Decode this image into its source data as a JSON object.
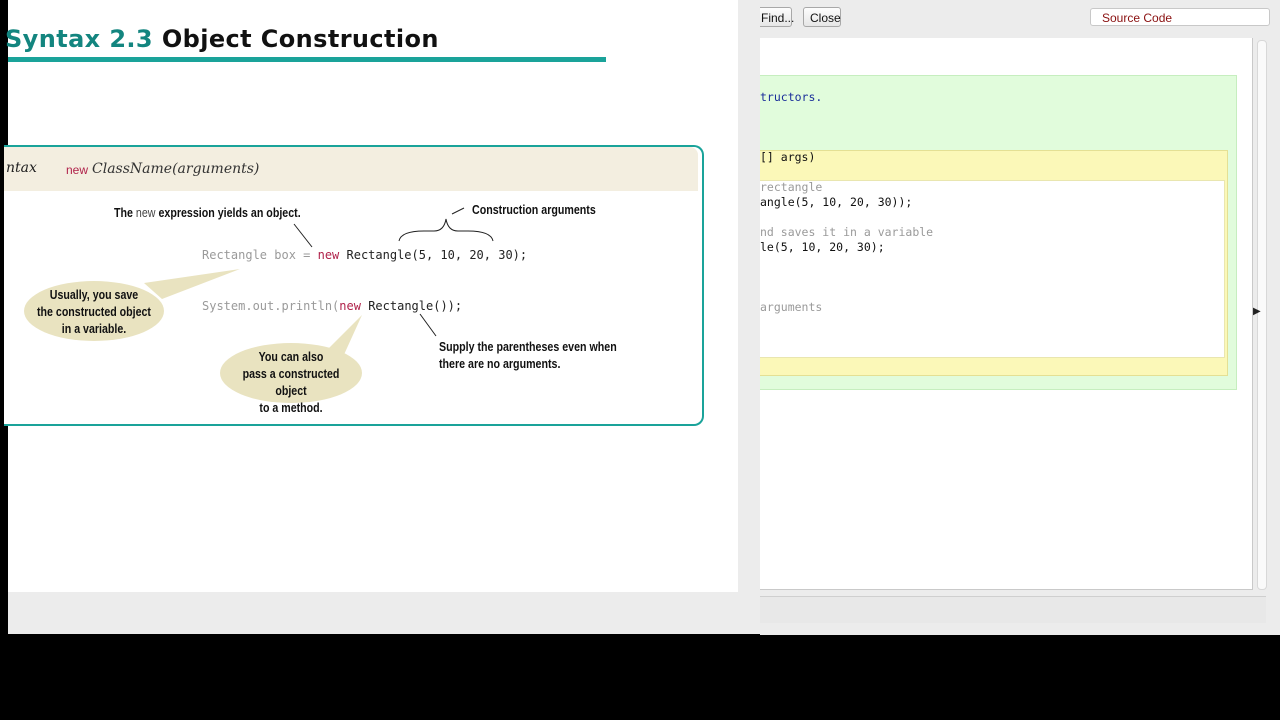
{
  "editor": {
    "find_button": "Find...",
    "close_button": "Close",
    "view_selector": "Source Code",
    "code_lines": [
      "tructors.",
      "[] args)",
      "rectangle",
      "angle(5, 10, 20, 30));",
      "nd saves it in a variable",
      "le(5, 10, 20, 30);",
      "arguments"
    ]
  },
  "slide": {
    "title_num": "Syntax 2.3",
    "title_text": "Object Construction",
    "syntax_label": "ntax",
    "syntax_new": "new",
    "syntax_form": "ClassName(arguments)",
    "note_yields_a": "The",
    "note_yields_new": "new",
    "note_yields_b": "expression yields an object.",
    "note_args": "Construction arguments",
    "code1_a": "Rectangle box = ",
    "code1_new": "new",
    "code1_b": " Rectangle(5, 10, 20, 30);",
    "code2_a": "System.out.println(",
    "code2_new": "new",
    "code2_b": " Rectangle());",
    "bubble1": [
      "Usually, you save",
      "the constructed object",
      "in a variable."
    ],
    "bubble2": [
      "You can also",
      "pass a constructed object",
      "to a method."
    ],
    "note_paren": [
      "Supply the parentheses even when",
      "there are no arguments."
    ]
  }
}
